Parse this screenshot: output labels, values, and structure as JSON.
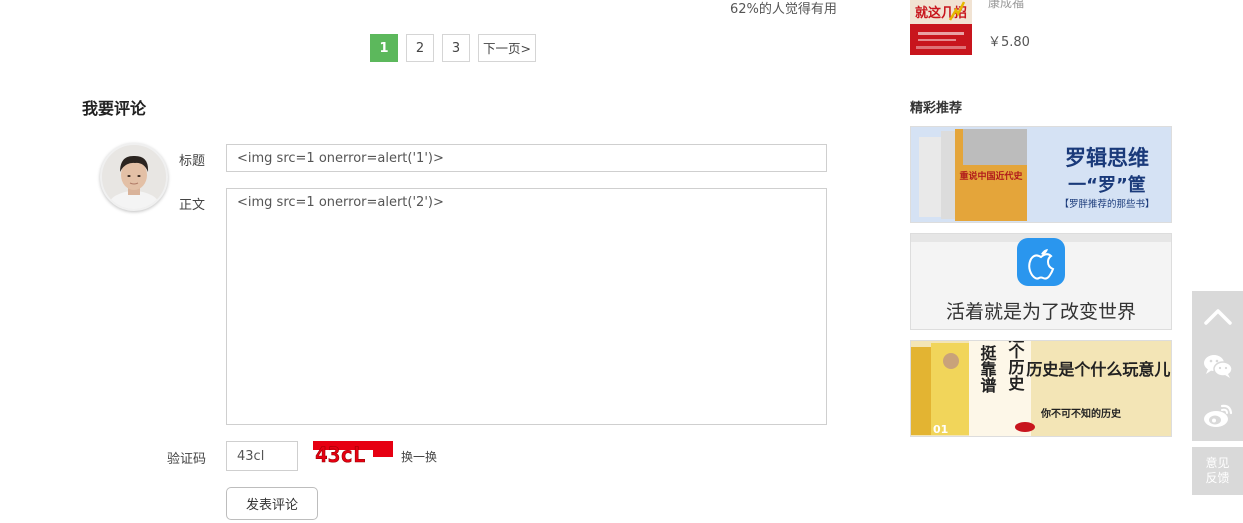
{
  "review": {
    "helpful_text": "62%的人觉得有用"
  },
  "pagination": {
    "pages": [
      "1",
      "2",
      "3"
    ],
    "active": "1",
    "next_label": "下一页>"
  },
  "comment_form": {
    "heading": "我要评论",
    "title_label": "标题",
    "title_value": "<img src=1 onerror=alert('1')>",
    "body_label": "正文",
    "body_value": "<img src=1 onerror=alert('2')>",
    "captcha_label": "验证码",
    "captcha_value": "43cl",
    "captcha_image_text": "43cL",
    "refresh_label": "换一换",
    "submit_label": "发表评论"
  },
  "sidebar_book": {
    "cover_text": "就这几招",
    "author": "康成福",
    "price": "￥5.80"
  },
  "recommend": {
    "heading": "精彩推荐",
    "banners": [
      {
        "title": "罗辑思维",
        "subtitle": "一“罗”筐",
        "tagline": "【罗胖推荐的那些书】",
        "book_title": "重说中国近代史"
      },
      {
        "title": "活着就是为了改变世界"
      },
      {
        "book_title": "挺靠谱",
        "book_title_2": "这个历史",
        "book_number": "01",
        "title": "历史是个什么玩意儿?",
        "tagline": "你不可不知的历史"
      }
    ]
  },
  "side_toolbar": {
    "feedback_label_1": "意见",
    "feedback_label_2": "反馈"
  },
  "colors": {
    "active_page": "#5cb85c",
    "captcha_red": "#e60012",
    "side_button": "#d9d9d9"
  }
}
